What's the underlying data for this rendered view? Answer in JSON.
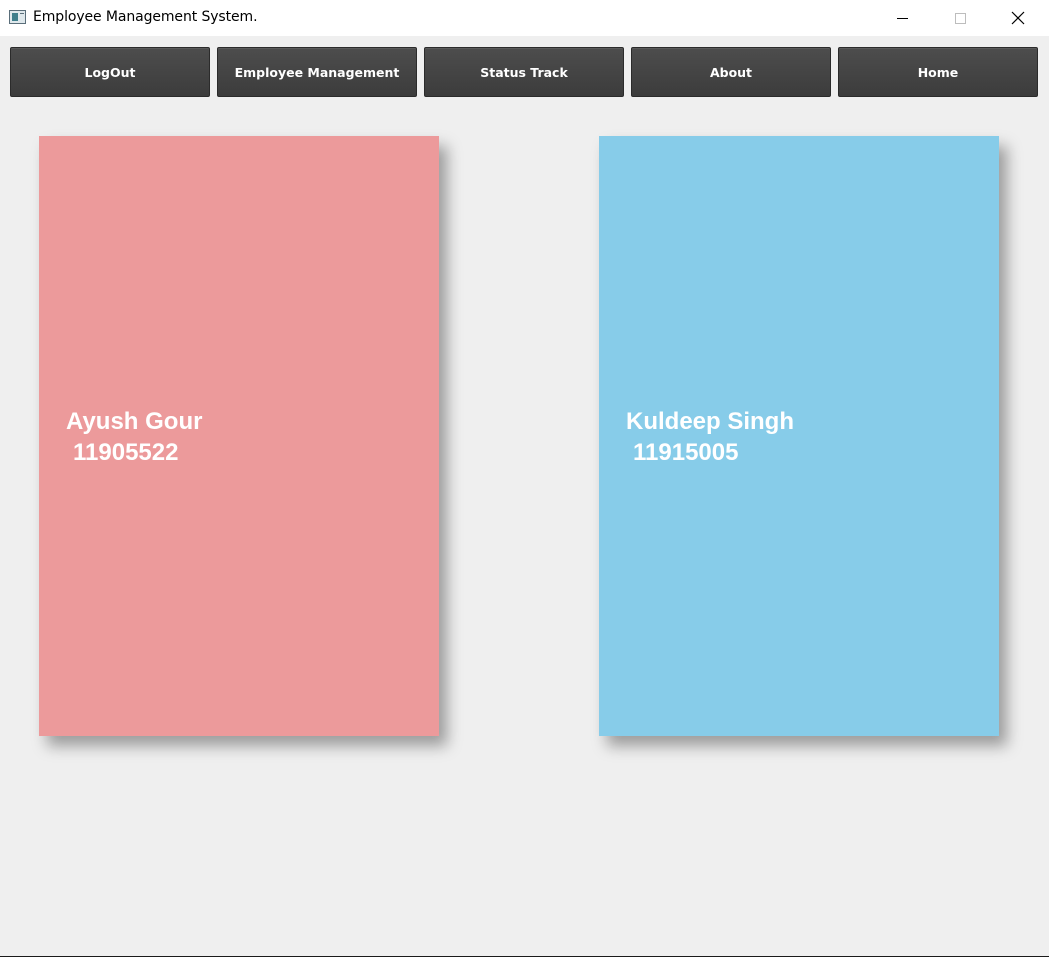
{
  "window": {
    "title": "Employee Management System.",
    "icon": "app-window-icon",
    "controls": [
      "minimize-icon",
      "maximize-icon",
      "close-icon"
    ]
  },
  "toolbar": {
    "buttons": [
      {
        "label": "LogOut"
      },
      {
        "label": "Employee Management"
      },
      {
        "label": "Status Track"
      },
      {
        "label": "About"
      },
      {
        "label": "Home"
      }
    ]
  },
  "cards": [
    {
      "name": "Ayush Gour",
      "id": "11905522",
      "color": "#ec9a9b"
    },
    {
      "name": "Kuldeep Singh",
      "id": "11915005",
      "color": "#87cce9"
    }
  ],
  "colors": {
    "button_bg": "#434343",
    "button_text": "#ffffff",
    "background": "#efefef"
  }
}
